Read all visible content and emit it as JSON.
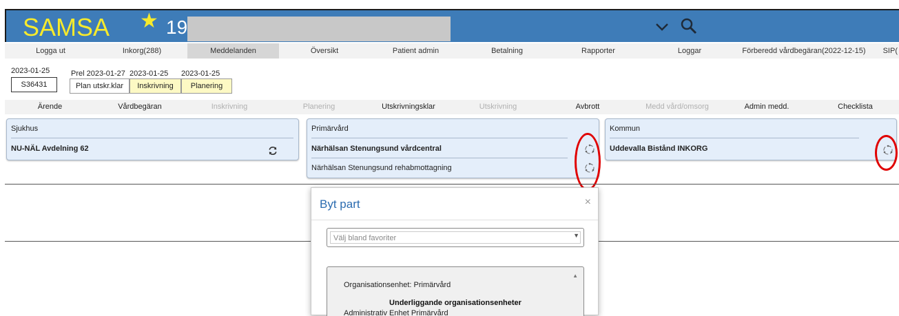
{
  "header": {
    "app_name": "SAMSA",
    "favorite_count": "19"
  },
  "nav": {
    "items": [
      {
        "label": "Logga ut"
      },
      {
        "label": "Inkorg(288)"
      },
      {
        "label": "Meddelanden",
        "active": true
      },
      {
        "label": "Översikt"
      },
      {
        "label": "Patient admin"
      },
      {
        "label": "Betalning"
      },
      {
        "label": "Rapporter"
      },
      {
        "label": "Loggar"
      },
      {
        "label": "Förberedd vårdbegäran(2022-12-15)"
      },
      {
        "label": "SIP("
      }
    ]
  },
  "case": {
    "date": "2023-01-25",
    "id": "S36431",
    "stages": [
      {
        "date": "Prel 2023-01-27",
        "label": "Plan utskr.klar"
      },
      {
        "date": "2023-01-25",
        "label": "Inskrivning"
      },
      {
        "date": "2023-01-25",
        "label": "Planering"
      }
    ]
  },
  "subnav": {
    "items": [
      {
        "label": "Ärende"
      },
      {
        "label": "Vårdbegäran"
      },
      {
        "label": "Inskrivning",
        "disabled": true
      },
      {
        "label": "Planering",
        "disabled": true
      },
      {
        "label": "Utskrivningsklar"
      },
      {
        "label": "Utskrivning",
        "disabled": true
      },
      {
        "label": "Avbrott"
      },
      {
        "label": "Medd vård/omsorg",
        "disabled": true
      },
      {
        "label": "Admin medd."
      },
      {
        "label": "Checklista"
      }
    ]
  },
  "panels": {
    "sjukhus": {
      "title": "Sjukhus",
      "rows": [
        "NU-NÄL Avdelning 62"
      ]
    },
    "primarvard": {
      "title": "Primärvård",
      "rows": [
        "Närhälsan Stenungsund vårdcentral",
        "Närhälsan Stenungsund rehabmottagning"
      ]
    },
    "kommun": {
      "title": "Kommun",
      "rows": [
        "Uddevalla Bistånd INKORG"
      ]
    }
  },
  "dialog": {
    "title": "Byt part",
    "close": "×",
    "select_placeholder": "Välj bland favoriter",
    "org_unit_label": "Organisationsenhet: Primärvård",
    "sub_units_heading": "Underliggande organisationsenheter",
    "sub_units": [
      "Administrativ Enhet Primärvård"
    ]
  },
  "colors": {
    "header_bg": "#3e7cb8",
    "logo": "#f7ea2c",
    "panel_bg": "#e4eefa",
    "highlight": "#e00000",
    "stage_bg": "#fdf9c4"
  }
}
